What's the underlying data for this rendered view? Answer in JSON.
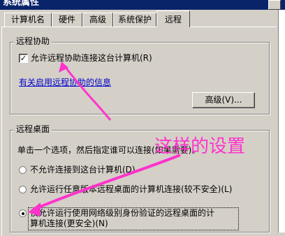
{
  "window": {
    "title": "系统属性"
  },
  "tabs": [
    {
      "label": "计算机名",
      "active": false
    },
    {
      "label": "硬件",
      "active": false
    },
    {
      "label": "高级",
      "active": false
    },
    {
      "label": "系统保护",
      "active": false
    },
    {
      "label": "远程",
      "active": true
    }
  ],
  "remote_assistance": {
    "title": "远程协助",
    "allow_label": "允许远程协助连接这台计算机(R)",
    "allow_checked": true,
    "help_link": "有关启用远程协助的信息",
    "advanced_button": "高级(V)..."
  },
  "remote_desktop": {
    "title": "远程桌面",
    "instruction": "单击一个选项，然后指定谁可以连接(如果需要)。",
    "options": [
      {
        "label": "不允许连接到这台计算机(D)",
        "checked": false
      },
      {
        "label": "允许运行任意版本远程桌面的计算机连接(较不安全)(L)",
        "checked": false
      },
      {
        "label_line1": "仅允许运行使用网络级别身份验证的远程桌面的计",
        "label_line2": "算机连接(更安全)(N)",
        "checked": true
      }
    ]
  },
  "annotation": {
    "text": "这样的设置",
    "color": "#ff33cc"
  }
}
